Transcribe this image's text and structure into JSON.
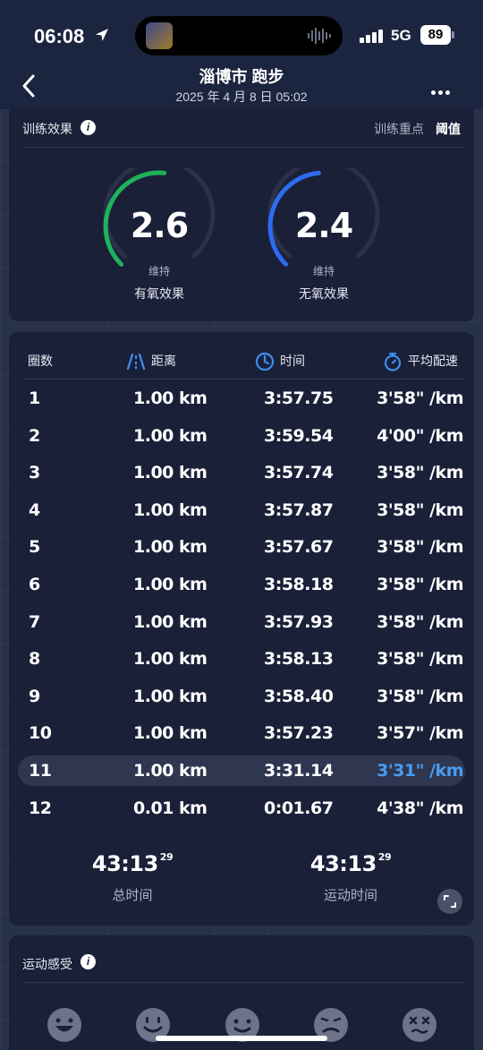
{
  "status_bar": {
    "time": "06:08",
    "network": "5G",
    "battery": "89"
  },
  "header": {
    "title": "淄博市 跑步",
    "subtitle": "2025 年 4 月 8 日 05:02"
  },
  "training_effect": {
    "label": "训练效果",
    "focus_label": "训练重点",
    "focus_value": "阈值",
    "aerobic": {
      "value": "2.6",
      "state": "维持",
      "name": "有氧效果",
      "level": 0.52,
      "color": "#1fb25a"
    },
    "anaerobic": {
      "value": "2.4",
      "state": "维持",
      "name": "无氧效果",
      "level": 0.48,
      "color": "#2f6bf0"
    }
  },
  "laps": {
    "headers": {
      "lap": "圈数",
      "distance": "距离",
      "time": "时间",
      "pace": "平均配速"
    },
    "rows": [
      {
        "lap": "1",
        "distance": "1.00 km",
        "time": "3:57.75",
        "pace": "3'58\" /km"
      },
      {
        "lap": "2",
        "distance": "1.00 km",
        "time": "3:59.54",
        "pace": "4'00\" /km"
      },
      {
        "lap": "3",
        "distance": "1.00 km",
        "time": "3:57.74",
        "pace": "3'58\" /km"
      },
      {
        "lap": "4",
        "distance": "1.00 km",
        "time": "3:57.87",
        "pace": "3'58\" /km"
      },
      {
        "lap": "5",
        "distance": "1.00 km",
        "time": "3:57.67",
        "pace": "3'58\" /km"
      },
      {
        "lap": "6",
        "distance": "1.00 km",
        "time": "3:58.18",
        "pace": "3'58\" /km"
      },
      {
        "lap": "7",
        "distance": "1.00 km",
        "time": "3:57.93",
        "pace": "3'58\" /km"
      },
      {
        "lap": "8",
        "distance": "1.00 km",
        "time": "3:58.13",
        "pace": "3'58\" /km"
      },
      {
        "lap": "9",
        "distance": "1.00 km",
        "time": "3:58.40",
        "pace": "3'58\" /km"
      },
      {
        "lap": "10",
        "distance": "1.00 km",
        "time": "3:57.23",
        "pace": "3'57\" /km"
      },
      {
        "lap": "11",
        "distance": "1.00 km",
        "time": "3:31.14",
        "pace": "3'31\" /km"
      },
      {
        "lap": "12",
        "distance": "0.01 km",
        "time": "0:01.67",
        "pace": "4'38\" /km"
      }
    ],
    "highlight_index": 10,
    "accent_color": "#4a9cf0",
    "total_time": {
      "main": "43:13",
      "hundredths": "29",
      "label": "总时间"
    },
    "moving_time": {
      "main": "43:13",
      "hundredths": "29",
      "label": "运动时间"
    }
  },
  "feeling": {
    "label": "运动感受",
    "faces": [
      "very-happy-face-icon",
      "happy-face-icon",
      "smile-face-icon",
      "uneasy-face-icon",
      "exhausted-face-icon"
    ]
  }
}
